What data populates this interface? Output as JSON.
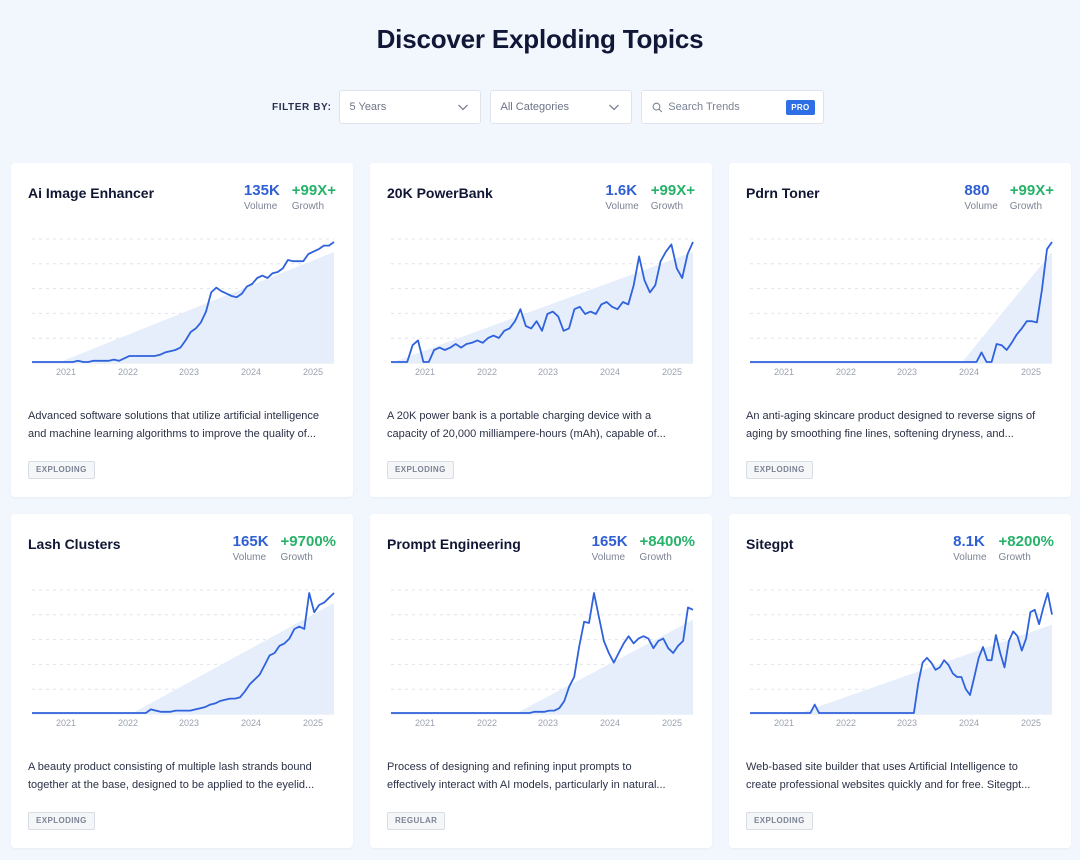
{
  "page": {
    "title": "Discover Exploding Topics"
  },
  "filters": {
    "label": "FILTER BY:",
    "timeframe": "5 Years",
    "category": "All Categories",
    "search_placeholder": "Search Trends",
    "pro_badge": "PRO"
  },
  "labels": {
    "volume": "Volume",
    "growth": "Growth"
  },
  "colors": {
    "accent": "#2f5fd4",
    "growth": "#27b26a",
    "line": "#2f62dd",
    "area": "#e6eefb"
  },
  "cards": [
    {
      "title": "Ai Image Enhancer",
      "volume": "135K",
      "growth": "+99X+",
      "desc_line1": "Advanced software solutions that utilize artificial intelligence",
      "desc_line2": "and machine learning algorithms to improve the quality of...",
      "status": "EXPLODING"
    },
    {
      "title": "20K PowerBank",
      "volume": "1.6K",
      "growth": "+99X+",
      "desc_line1": "A 20K power bank is a portable charging device with a",
      "desc_line2": "capacity of 20,000 milliampere-hours (mAh), capable of...",
      "status": "EXPLODING"
    },
    {
      "title": "Pdrn Toner",
      "volume": "880",
      "growth": "+99X+",
      "desc_line1": "An anti-aging skincare product designed to reverse signs of",
      "desc_line2": "aging by smoothing fine lines, softening dryness, and...",
      "status": "EXPLODING"
    },
    {
      "title": "Lash Clusters",
      "volume": "165K",
      "growth": "+9700%",
      "desc_line1": "A beauty product consisting of multiple lash strands bound",
      "desc_line2": "together at the base, designed to be applied to the eyelid...",
      "status": "EXPLODING"
    },
    {
      "title": "Prompt Engineering",
      "volume": "165K",
      "growth": "+8400%",
      "desc_line1": "Process of designing and refining input prompts to",
      "desc_line2": "effectively interact with AI models, particularly in natural...",
      "status": "REGULAR"
    },
    {
      "title": "Sitegpt",
      "volume": "8.1K",
      "growth": "+8200%",
      "desc_line1": "Web-based site builder that uses Artificial Intelligence to",
      "desc_line2": "create professional websites quickly and for free. Sitegpt...",
      "status": "EXPLODING"
    }
  ],
  "chart_data": [
    {
      "type": "area",
      "series_of": "Ai Image Enhancer",
      "x_ticks": [
        "2021",
        "2022",
        "2023",
        "2024",
        "2025"
      ],
      "ylim": [
        0,
        100
      ],
      "values": [
        0,
        0,
        0,
        0,
        0,
        0,
        0,
        0,
        0,
        1,
        0,
        0,
        1,
        1,
        1,
        1,
        2,
        1,
        3,
        5,
        5,
        5,
        5,
        5,
        5,
        6,
        8,
        9,
        10,
        12,
        18,
        25,
        28,
        33,
        42,
        58,
        62,
        59,
        57,
        55,
        54,
        57,
        63,
        65,
        70,
        72,
        70,
        74,
        75,
        78,
        85,
        84,
        84,
        84,
        90,
        92,
        94,
        97,
        97,
        100
      ]
    },
    {
      "type": "area",
      "series_of": "20K PowerBank",
      "x_ticks": [
        "2021",
        "2022",
        "2023",
        "2024",
        "2025"
      ],
      "ylim": [
        0,
        100
      ],
      "values": [
        0,
        0,
        0,
        0,
        14,
        18,
        0,
        0,
        10,
        12,
        10,
        12,
        15,
        12,
        15,
        16,
        18,
        16,
        20,
        22,
        20,
        26,
        28,
        34,
        44,
        30,
        28,
        34,
        26,
        40,
        42,
        38,
        26,
        28,
        44,
        46,
        40,
        42,
        40,
        48,
        50,
        46,
        44,
        50,
        48,
        64,
        88,
        68,
        58,
        64,
        84,
        92,
        98,
        78,
        70,
        90,
        100
      ]
    },
    {
      "type": "area",
      "series_of": "Pdrn Toner",
      "x_ticks": [
        "2021",
        "2022",
        "2023",
        "2024",
        "2025"
      ],
      "ylim": [
        0,
        100
      ],
      "values": [
        0,
        0,
        0,
        0,
        0,
        0,
        0,
        0,
        0,
        0,
        0,
        0,
        0,
        0,
        0,
        0,
        0,
        0,
        0,
        0,
        0,
        0,
        0,
        0,
        0,
        0,
        0,
        0,
        0,
        0,
        0,
        0,
        0,
        0,
        0,
        0,
        0,
        0,
        0,
        0,
        0,
        0,
        0,
        0,
        0,
        0,
        8,
        0,
        0,
        15,
        14,
        10,
        16,
        23,
        28,
        34,
        34,
        33,
        60,
        94,
        100
      ]
    },
    {
      "type": "area",
      "series_of": "Lash Clusters",
      "x_ticks": [
        "2021",
        "2022",
        "2023",
        "2024",
        "2025"
      ],
      "ylim": [
        0,
        100
      ],
      "values": [
        0,
        0,
        0,
        0,
        0,
        0,
        0,
        0,
        0,
        0,
        0,
        0,
        0,
        0,
        0,
        0,
        0,
        0,
        0,
        0,
        0,
        0,
        0,
        0,
        3,
        2,
        1,
        1,
        1,
        2,
        2,
        2,
        2,
        3,
        4,
        5,
        7,
        8,
        10,
        11,
        12,
        12,
        13,
        18,
        24,
        28,
        32,
        40,
        48,
        50,
        56,
        58,
        62,
        70,
        72,
        70,
        100,
        84,
        90,
        92,
        96,
        100
      ]
    },
    {
      "type": "area",
      "series_of": "Prompt Engineering",
      "x_ticks": [
        "2021",
        "2022",
        "2023",
        "2024",
        "2025"
      ],
      "ylim": [
        0,
        100
      ],
      "values": [
        0,
        0,
        0,
        0,
        0,
        0,
        0,
        0,
        0,
        0,
        0,
        0,
        0,
        0,
        0,
        0,
        0,
        0,
        0,
        0,
        0,
        0,
        0,
        0,
        0,
        0,
        0,
        0,
        0,
        1,
        1,
        1,
        2,
        2,
        4,
        10,
        22,
        30,
        55,
        76,
        75,
        100,
        80,
        60,
        50,
        42,
        50,
        58,
        64,
        58,
        62,
        64,
        62,
        54,
        60,
        62,
        54,
        50,
        56,
        60,
        88,
        86
      ]
    },
    {
      "type": "area",
      "series_of": "Sitegpt",
      "x_ticks": [
        "2021",
        "2022",
        "2023",
        "2024",
        "2025"
      ],
      "ylim": [
        0,
        100
      ],
      "values": [
        0,
        0,
        0,
        0,
        0,
        0,
        0,
        0,
        0,
        0,
        0,
        0,
        0,
        0,
        0,
        7,
        0,
        0,
        0,
        0,
        0,
        0,
        0,
        0,
        0,
        0,
        0,
        0,
        0,
        0,
        0,
        0,
        0,
        0,
        0,
        0,
        0,
        0,
        0,
        25,
        42,
        46,
        42,
        36,
        38,
        44,
        40,
        33,
        30,
        30,
        20,
        15,
        30,
        46,
        55,
        44,
        44,
        65,
        50,
        38,
        60,
        68,
        64,
        52,
        62,
        84,
        86,
        74,
        88,
        100,
        82
      ]
    }
  ]
}
